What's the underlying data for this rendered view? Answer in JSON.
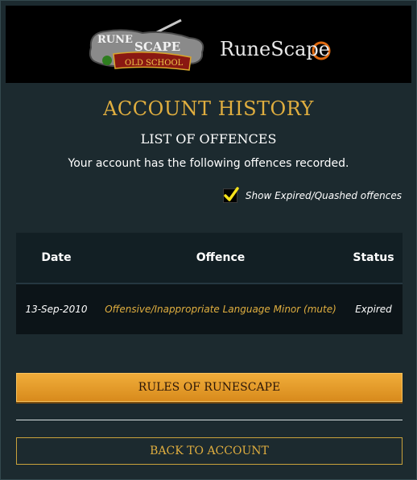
{
  "header": {
    "osrs_logo_text": [
      "RUNE",
      "SCAPE",
      "OLD SCHOOL"
    ],
    "rs_logo_text": "RuneScape"
  },
  "page": {
    "title": "ACCOUNT HISTORY",
    "subtitle": "LIST OF OFFENCES",
    "intro": "Your account has the following offences recorded."
  },
  "filter": {
    "checked": true,
    "label": "Show Expired/Quashed offences"
  },
  "table": {
    "columns": [
      "Date",
      "Offence",
      "Status"
    ],
    "rows": [
      {
        "date": "13-Sep-2010",
        "offence": "Offensive/Inappropriate Language Minor (mute)",
        "status": "Expired"
      }
    ]
  },
  "buttons": {
    "rules": "RULES OF RUNESCAPE",
    "back": "BACK TO ACCOUNT"
  },
  "colors": {
    "accent_gold": "#e0ae3f",
    "button_orange": "#e99c2c",
    "panel_bg": "#1c2a2f"
  }
}
